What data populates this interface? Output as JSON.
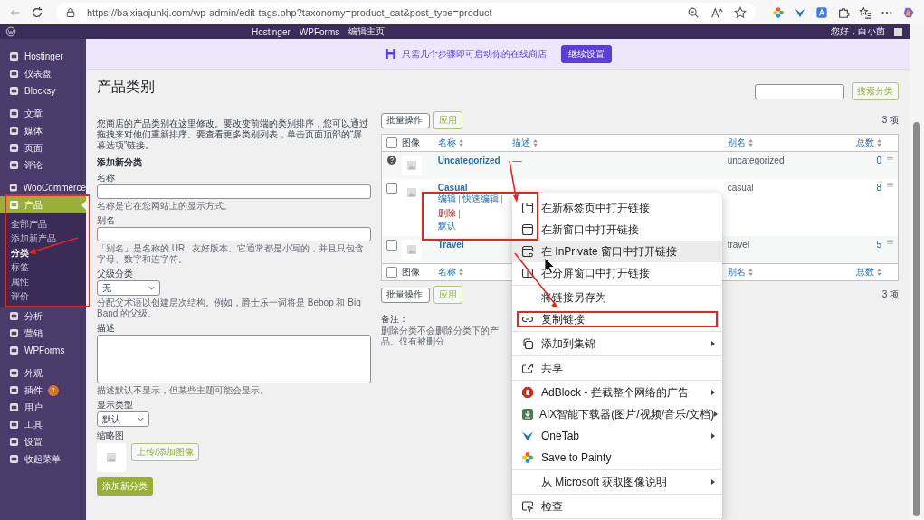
{
  "browser": {
    "url": "https://baixiaojunkj.com/wp-admin/edit-tags.php?taxonomy=product_cat&post_type=product"
  },
  "admin_bar": {
    "links": [
      "Hostinger",
      "WPForms",
      "编辑主页"
    ],
    "greeting": "您好，白小菌"
  },
  "banner": {
    "text": "只需几个步骤即可启动你的在线商店",
    "button": "继续设置"
  },
  "sidebar": {
    "groups": [
      [
        {
          "label": "Hostinger",
          "selected": false
        },
        {
          "label": "仪表盘",
          "selected": false
        },
        {
          "label": "Blocksy",
          "selected": false
        }
      ],
      [
        {
          "label": "文章",
          "selected": false
        },
        {
          "label": "媒体",
          "selected": false
        },
        {
          "label": "页面",
          "selected": false
        },
        {
          "label": "评论",
          "selected": false
        }
      ],
      [
        {
          "label": "WooCommerce",
          "selected": false
        },
        {
          "label": "产品",
          "selected": true,
          "children": [
            {
              "label": "全部产品",
              "selected": false
            },
            {
              "label": "添加新产品",
              "selected": false
            },
            {
              "label": "分类",
              "selected": true
            },
            {
              "label": "标签",
              "selected": false
            },
            {
              "label": "属性",
              "selected": false
            },
            {
              "label": "评价",
              "selected": false
            }
          ]
        },
        {
          "label": "分析",
          "selected": false
        },
        {
          "label": "营销",
          "selected": false
        },
        {
          "label": "WPForms",
          "selected": false
        }
      ],
      [
        {
          "label": "外观",
          "selected": false
        },
        {
          "label": "插件",
          "selected": false,
          "badge": "1"
        },
        {
          "label": "用户",
          "selected": false
        },
        {
          "label": "工具",
          "selected": false
        },
        {
          "label": "设置",
          "selected": false
        },
        {
          "label": "收起菜单",
          "selected": false
        }
      ]
    ]
  },
  "page": {
    "title": "产品类别",
    "intro": "您商店的产品类别在这里修改。要改变前端的类别排序，您可以通过拖拽来对他们重新排序。要查看更多类别列表，单击页面顶部的“屏幕选项”链接。"
  },
  "form": {
    "heading": "添加新分类",
    "fields": [
      {
        "kind": "text",
        "label": "名称",
        "help": "名称是它在您网站上的显示方式。"
      },
      {
        "kind": "text",
        "label": "别名",
        "help": "「别名」是名称的 URL 友好版本。它通常都是小写的，并且只包含字母、数字和连字符。"
      },
      {
        "kind": "select",
        "label": "父级分类",
        "value": "无",
        "help": "分配父术语以创建层次结构。例如，爵士乐一词将是 Bebop 和 Big Band 的父级。"
      },
      {
        "kind": "textarea",
        "label": "描述",
        "help": "描述默认不显示，但某些主题可能会显示。"
      },
      {
        "kind": "select",
        "label": "显示类型",
        "value": "默认"
      },
      {
        "kind": "thumbnail",
        "label": "缩略图",
        "button": "上传/添加图像"
      }
    ],
    "submit": "添加新分类"
  },
  "table": {
    "search_button": "搜索分类",
    "header_checked": false,
    "footer_checked": false,
    "bulk_top": {
      "value": "批量操作",
      "apply": "应用",
      "count": "3 项"
    },
    "columns": [
      {
        "label": "图像",
        "sortable": false
      },
      {
        "label": "名称",
        "sortable": true
      },
      {
        "label": "描述",
        "sortable": true
      },
      {
        "label": "别名",
        "sortable": true
      },
      {
        "label": "总数",
        "sortable": true
      }
    ],
    "rows": [
      {
        "kind": "default",
        "name": "Uncategorized",
        "description": "—",
        "slug": "uncategorized",
        "count": "0"
      },
      {
        "kind": "normal",
        "checked": false,
        "name": "Casual",
        "actions": [
          {
            "label": "编辑",
            "kind": "link"
          },
          {
            "label": "快速编辑",
            "kind": "link"
          },
          {
            "label": "删除",
            "kind": "delete"
          }
        ],
        "extra": "默认",
        "slug": "casual",
        "count": "8"
      },
      {
        "kind": "normal",
        "checked": false,
        "name": "Travel",
        "slug": "travel",
        "count": "5"
      }
    ],
    "footer_columns": [
      {
        "label": "图像",
        "sortable": false
      },
      {
        "label": "名称",
        "sortable": true
      },
      {
        "label": "别名",
        "sortable": true
      },
      {
        "label": "总数",
        "sortable": true
      }
    ],
    "bulk_bottom": {
      "value": "批量操作",
      "apply": "应用",
      "count": "3 项"
    },
    "note_label": "备注：",
    "note": "删除分类不会删除分类下的产品。仅有被删分"
  },
  "context_menu": {
    "groups": [
      [
        {
          "label": "在新标签页中打开链接",
          "highlighted": false,
          "submenu": false
        },
        {
          "label": "在新窗口中打开链接",
          "highlighted": false,
          "submenu": false
        },
        {
          "label": "在 InPrivate 窗口中打开链接",
          "highlighted": true,
          "submenu": false
        },
        {
          "label": "在分屏窗口中打开链接",
          "highlighted": false,
          "submenu": false
        }
      ],
      [
        {
          "label": "将链接另存为",
          "highlighted": false,
          "submenu": false
        },
        {
          "label": "复制链接",
          "highlighted": false,
          "submenu": false
        }
      ],
      [
        {
          "label": "添加到集锦",
          "highlighted": false,
          "submenu": true
        }
      ],
      [
        {
          "label": "共享",
          "highlighted": false,
          "submenu": false
        }
      ],
      [
        {
          "label": "AdBlock - 拦截整个网络的广告",
          "highlighted": false,
          "submenu": true
        },
        {
          "label": "AIX智能下载器(图片/视频/音乐/文档)",
          "highlighted": false,
          "submenu": true
        },
        {
          "label": "OneTab",
          "highlighted": false,
          "submenu": true
        },
        {
          "label": "Save to Painty",
          "highlighted": false,
          "submenu": false
        }
      ],
      [
        {
          "label": "从 Microsoft 获取图像说明",
          "highlighted": false,
          "submenu": true
        }
      ],
      [
        {
          "label": "检查",
          "highlighted": false,
          "submenu": false
        }
      ]
    ]
  }
}
